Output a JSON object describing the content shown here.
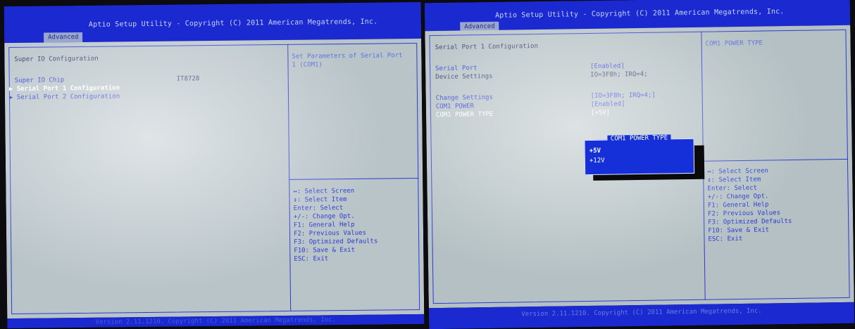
{
  "left_screen": {
    "title": "Aptio Setup Utility - Copyright (C) 2011 American Megatrends, Inc.",
    "tab": "Advanced",
    "section_title": "Super IO Configuration",
    "chip_label": "Super IO Chip",
    "chip_value": "IT8728",
    "items": [
      "Serial Port 1 Configuration",
      "Serial Port 2 Configuration"
    ],
    "help_text_line1": "Set Parameters of Serial Port",
    "help_text_line2": "1 (COM1)",
    "keys": [
      "↔: Select Screen",
      "↕: Select Item",
      "Enter: Select",
      "+/-: Change Opt.",
      "F1: General Help",
      "F2: Previous Values",
      "F3: Optimized Defaults",
      "F10: Save & Exit",
      "ESC: Exit"
    ],
    "footer": "Version 2.11.1210. Copyright (C) 2011 American Megatrends, Inc."
  },
  "right_screen": {
    "title": "Aptio Setup Utility - Copyright (C) 2011 American Megatrends, Inc.",
    "tab": "Advanced",
    "section_title": "Serial Port 1 Configuration",
    "rows": [
      {
        "label": "Serial Port",
        "value": "[Enabled]"
      },
      {
        "label": "Device Settings",
        "value": "IO=3F8h; IRQ=4;"
      },
      {
        "label": "Change Settings",
        "value": "[IO=3F8h; IRQ=4;]"
      },
      {
        "label": "COM1 POWER",
        "value": "[Enabled]"
      },
      {
        "label": "COM1 POWER TYPE",
        "value": "[+5V]"
      }
    ],
    "help_title": "COM1 POWER TYPE",
    "popup": {
      "title": "COM1 POWER TYPE",
      "options": [
        "+5V",
        "+12V"
      ]
    },
    "keys": [
      "↔: Select Screen",
      "↕: Select Item",
      "Enter: Select",
      "+/-: Change Opt.",
      "F1: General Help",
      "F2: Previous Values",
      "F3: Optimized Defaults",
      "F10: Save & Exit",
      "ESC: Exit"
    ],
    "footer": "Version 2.11.1210. Copyright (C) 2011 American Megatrends, Inc."
  }
}
